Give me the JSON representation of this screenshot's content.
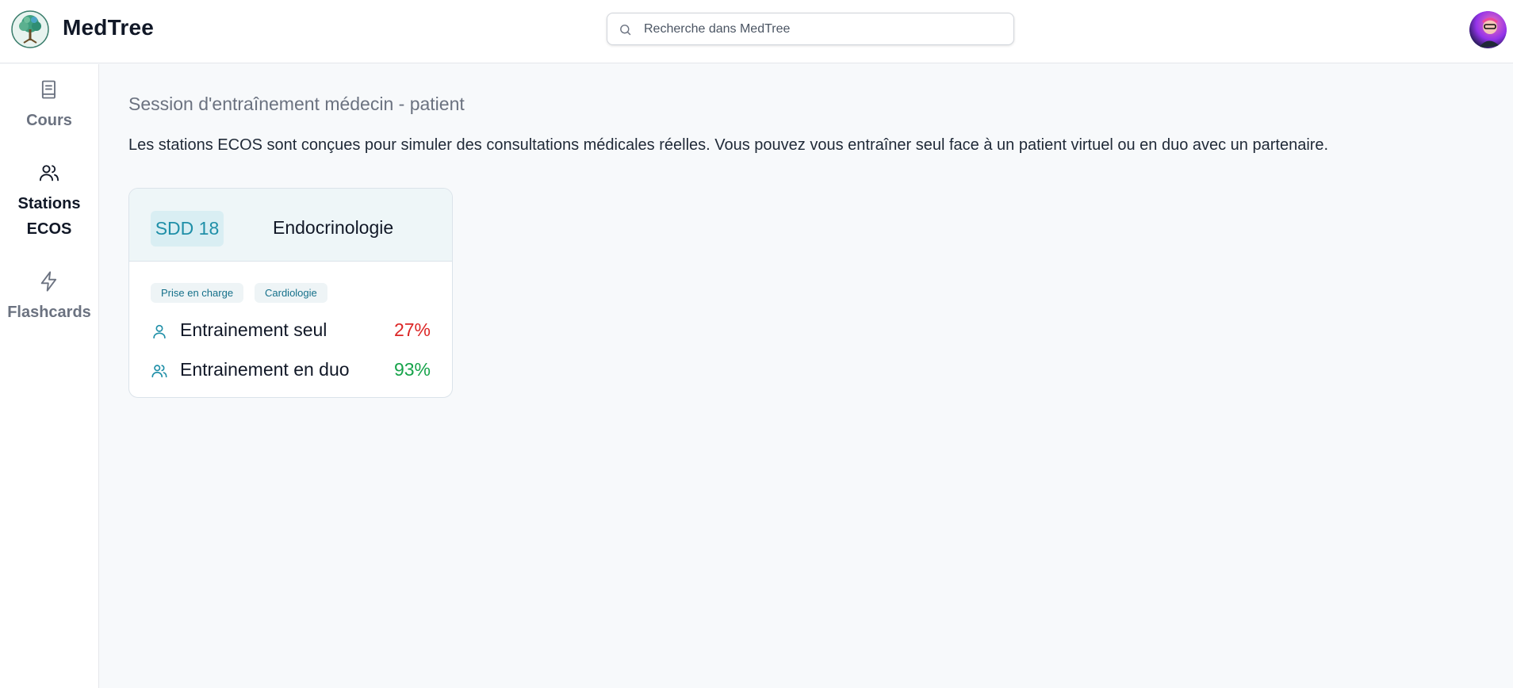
{
  "header": {
    "brand": "MedTree",
    "search": {
      "placeholder": "Recherche dans MedTree",
      "value": ""
    },
    "logo_icon": "tree-logo",
    "avatar_icon": "user-avatar"
  },
  "sidebar": {
    "items": [
      {
        "label": "Cours",
        "icon": "book-icon",
        "active": false
      },
      {
        "label": "Stations ECOS",
        "icon": "users-icon",
        "active": true
      },
      {
        "label": "Flashcards",
        "icon": "bolt-icon",
        "active": false
      }
    ]
  },
  "main": {
    "title": "Session d'entraînement médecin - patient",
    "description": "Les stations ECOS sont conçues pour simuler des consultations médicales réelles. Vous pouvez vous entraîner seul face à un patient virtuel ou en duo avec un partenaire.",
    "cards": [
      {
        "code": "SDD 18",
        "specialty": "Endocrinologie",
        "tags": [
          "Prise en charge",
          "Cardiologie"
        ],
        "modes": [
          {
            "label": "Entrainement seul",
            "percent": "27%",
            "icon": "user-icon",
            "color": "#dc2626"
          },
          {
            "label": "Entrainement en duo",
            "percent": "93%",
            "icon": "users-icon",
            "color": "#16a34a"
          }
        ]
      }
    ]
  },
  "colors": {
    "accent": "#1f8fa8",
    "low_score": "#dc2626",
    "high_score": "#16a34a"
  }
}
